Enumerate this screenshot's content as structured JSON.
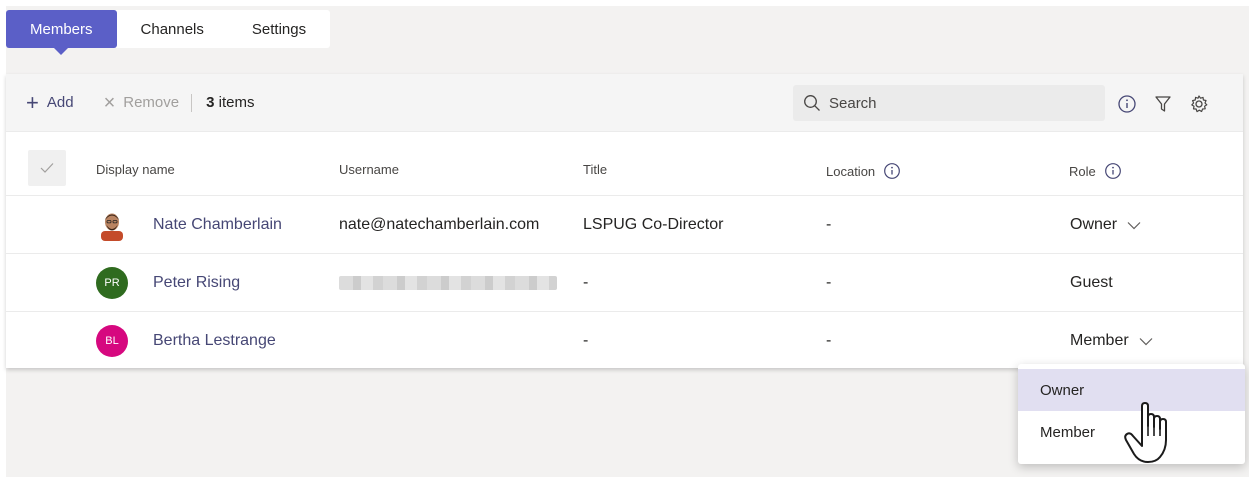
{
  "tabs": [
    {
      "label": "Members",
      "active": true
    },
    {
      "label": "Channels",
      "active": false
    },
    {
      "label": "Settings",
      "active": false
    }
  ],
  "toolbar": {
    "add_label": "Add",
    "remove_label": "Remove",
    "item_count": "3",
    "item_count_suffix": "items",
    "search_placeholder": "Search"
  },
  "columns": {
    "display_name": "Display name",
    "username": "Username",
    "title": "Title",
    "location": "Location",
    "role": "Role"
  },
  "members": [
    {
      "initials": "",
      "name": "Nate Chamberlain",
      "username": "nate@natechamberlain.com",
      "title": "LSPUG Co-Director",
      "location": "-",
      "role": "Owner",
      "role_editable": true,
      "avatar_color": "#ffffff"
    },
    {
      "initials": "PR",
      "name": "Peter Rising",
      "username": "",
      "title": "-",
      "location": "-",
      "role": "Guest",
      "role_editable": false,
      "avatar_color": "#2f6b1f"
    },
    {
      "initials": "BL",
      "name": "Bertha Lestrange",
      "username": "",
      "title": "-",
      "location": "-",
      "role": "Member",
      "role_editable": true,
      "avatar_color": "#d6087f"
    }
  ],
  "role_menu": {
    "options": [
      "Owner",
      "Member"
    ],
    "highlighted": "Owner"
  },
  "colors": {
    "accent": "#5b5fc7",
    "link": "#464775",
    "menu_hover": "#e1dff1"
  }
}
